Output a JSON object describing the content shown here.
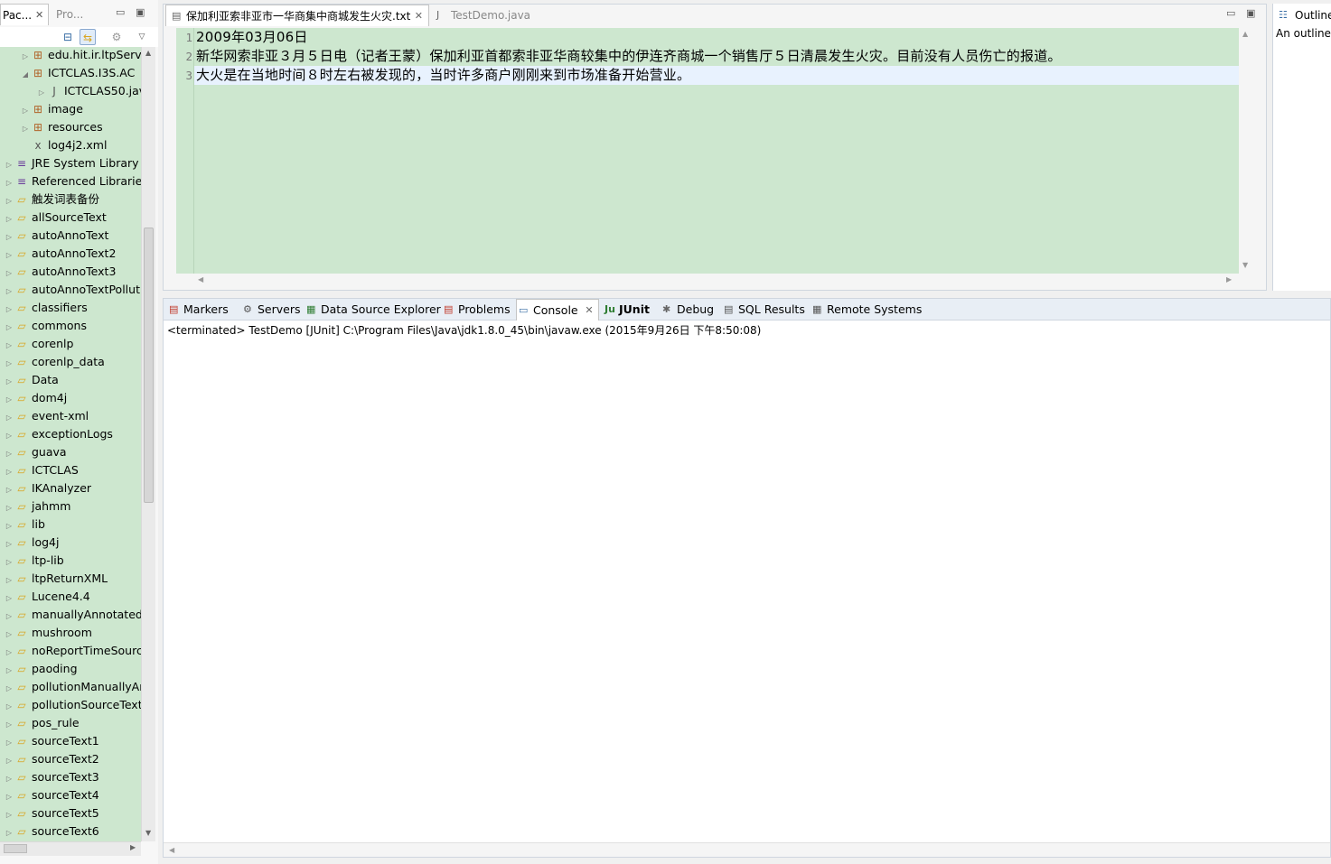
{
  "left_panel": {
    "tab_active": "Pac...",
    "tab_inactive": "Pro...",
    "close_glyph": "✕",
    "minimize_glyph": "▭",
    "maximize_glyph": "▣",
    "tree": [
      {
        "label": "edu.hit.ir.ltpServi",
        "icon": "package-icon",
        "indent": 2,
        "arrow": "▷"
      },
      {
        "label": "ICTCLAS.I3S.AC",
        "icon": "package-icon",
        "indent": 2,
        "arrow": "◢"
      },
      {
        "label": "ICTCLAS50.jav",
        "icon": "java-file-icon",
        "indent": 3,
        "arrow": "▷"
      },
      {
        "label": "image",
        "icon": "package-icon",
        "indent": 2,
        "arrow": "▷"
      },
      {
        "label": "resources",
        "icon": "package-icon",
        "indent": 2,
        "arrow": "▷"
      },
      {
        "label": "log4j2.xml",
        "icon": "xml-file-icon",
        "indent": 2,
        "arrow": ""
      },
      {
        "label": "JRE System Library [",
        "icon": "library-icon",
        "indent": 1,
        "arrow": "▷"
      },
      {
        "label": "Referenced Libraries",
        "icon": "library-icon",
        "indent": 1,
        "arrow": "▷"
      },
      {
        "label": "触发词表备份",
        "icon": "folder-icon",
        "indent": 1,
        "arrow": "▷"
      },
      {
        "label": "allSourceText",
        "icon": "folder-icon",
        "indent": 1,
        "arrow": "▷"
      },
      {
        "label": "autoAnnoText",
        "icon": "folder-icon",
        "indent": 1,
        "arrow": "▷"
      },
      {
        "label": "autoAnnoText2",
        "icon": "folder-icon",
        "indent": 1,
        "arrow": "▷"
      },
      {
        "label": "autoAnnoText3",
        "icon": "folder-icon",
        "indent": 1,
        "arrow": "▷"
      },
      {
        "label": "autoAnnoTextPolluti",
        "icon": "folder-icon",
        "indent": 1,
        "arrow": "▷"
      },
      {
        "label": "classifiers",
        "icon": "folder-icon",
        "indent": 1,
        "arrow": "▷"
      },
      {
        "label": "commons",
        "icon": "folder-icon",
        "indent": 1,
        "arrow": "▷"
      },
      {
        "label": "corenlp",
        "icon": "folder-icon",
        "indent": 1,
        "arrow": "▷"
      },
      {
        "label": "corenlp_data",
        "icon": "folder-icon",
        "indent": 1,
        "arrow": "▷"
      },
      {
        "label": "Data",
        "icon": "folder-icon",
        "indent": 1,
        "arrow": "▷"
      },
      {
        "label": "dom4j",
        "icon": "folder-icon",
        "indent": 1,
        "arrow": "▷"
      },
      {
        "label": "event-xml",
        "icon": "folder-icon",
        "indent": 1,
        "arrow": "▷"
      },
      {
        "label": "exceptionLogs",
        "icon": "folder-icon",
        "indent": 1,
        "arrow": "▷"
      },
      {
        "label": "guava",
        "icon": "folder-icon",
        "indent": 1,
        "arrow": "▷"
      },
      {
        "label": "ICTCLAS",
        "icon": "folder-icon",
        "indent": 1,
        "arrow": "▷"
      },
      {
        "label": "IKAnalyzer",
        "icon": "folder-icon",
        "indent": 1,
        "arrow": "▷"
      },
      {
        "label": "jahmm",
        "icon": "folder-icon",
        "indent": 1,
        "arrow": "▷"
      },
      {
        "label": "lib",
        "icon": "folder-icon",
        "indent": 1,
        "arrow": "▷"
      },
      {
        "label": "log4j",
        "icon": "folder-icon",
        "indent": 1,
        "arrow": "▷"
      },
      {
        "label": "ltp-lib",
        "icon": "folder-icon",
        "indent": 1,
        "arrow": "▷"
      },
      {
        "label": "ltpReturnXML",
        "icon": "folder-icon",
        "indent": 1,
        "arrow": "▷"
      },
      {
        "label": "Lucene4.4",
        "icon": "folder-icon",
        "indent": 1,
        "arrow": "▷"
      },
      {
        "label": "manuallyAnnotated",
        "icon": "folder-icon",
        "indent": 1,
        "arrow": "▷"
      },
      {
        "label": "mushroom",
        "icon": "folder-icon",
        "indent": 1,
        "arrow": "▷"
      },
      {
        "label": "noReportTimeSourc",
        "icon": "folder-icon",
        "indent": 1,
        "arrow": "▷"
      },
      {
        "label": "paoding",
        "icon": "folder-icon",
        "indent": 1,
        "arrow": "▷"
      },
      {
        "label": "pollutionManuallyAr",
        "icon": "folder-icon",
        "indent": 1,
        "arrow": "▷"
      },
      {
        "label": "pollutionSourceText",
        "icon": "folder-icon",
        "indent": 1,
        "arrow": "▷"
      },
      {
        "label": "pos_rule",
        "icon": "folder-icon",
        "indent": 1,
        "arrow": "▷"
      },
      {
        "label": "sourceText1",
        "icon": "folder-icon",
        "indent": 1,
        "arrow": "▷"
      },
      {
        "label": "sourceText2",
        "icon": "folder-icon",
        "indent": 1,
        "arrow": "▷"
      },
      {
        "label": "sourceText3",
        "icon": "folder-icon",
        "indent": 1,
        "arrow": "▷"
      },
      {
        "label": "sourceText4",
        "icon": "folder-icon",
        "indent": 1,
        "arrow": "▷"
      },
      {
        "label": "sourceText5",
        "icon": "folder-icon",
        "indent": 1,
        "arrow": "▷"
      },
      {
        "label": "sourceText6",
        "icon": "folder-icon",
        "indent": 1,
        "arrow": "▷"
      }
    ]
  },
  "editor": {
    "tabs": [
      {
        "label": "保加利亚索非亚市一华商集中商城发生火灾.txt",
        "active": true
      },
      {
        "label": "TestDemo.java",
        "active": false
      }
    ],
    "lines": [
      {
        "num": "1",
        "text": "2009年03月06日"
      },
      {
        "num": "2",
        "text": "新华网索非亚３月５日电（记者王蒙）保加利亚首都索非亚华商较集中的伊连齐商城一个销售厅５日清晨发生火灾。目前没有人员伤亡的报道。"
      },
      {
        "num": "3",
        "text": "大火是在当地时间８时左右被发现的，当时许多商户刚刚来到市场准备开始营业。"
      }
    ],
    "background_color": "#cde7cf"
  },
  "outline": {
    "title": "Outline",
    "message": "An outline"
  },
  "bottom_panel": {
    "tabs": [
      {
        "label": "Markers",
        "icon": "markers-icon",
        "glyph": "▤",
        "active": false
      },
      {
        "label": "Servers",
        "icon": "servers-icon",
        "glyph": "⚙",
        "active": false
      },
      {
        "label": "Data Source Explorer",
        "icon": "data-source-icon",
        "glyph": "▦",
        "active": false
      },
      {
        "label": "Problems",
        "icon": "problems-icon",
        "glyph": "▤",
        "active": false
      },
      {
        "label": "Console",
        "icon": "console-icon",
        "glyph": "▭",
        "active": true
      },
      {
        "label": "JUnit",
        "icon": "junit-icon",
        "glyph": "Ju",
        "active": false
      },
      {
        "label": "Debug",
        "icon": "debug-icon",
        "glyph": "✱",
        "active": false
      },
      {
        "label": "SQL Results",
        "icon": "sql-results-icon",
        "glyph": "▤",
        "active": false
      },
      {
        "label": "Remote Systems",
        "icon": "remote-systems-icon",
        "glyph": "▦",
        "active": false
      }
    ],
    "console_status": "<terminated> TestDemo [JUnit] C:\\Program Files\\Java\\jdk1.8.0_45\\bin\\javaw.exe (2015年9月26日 下午8:50:08)"
  }
}
